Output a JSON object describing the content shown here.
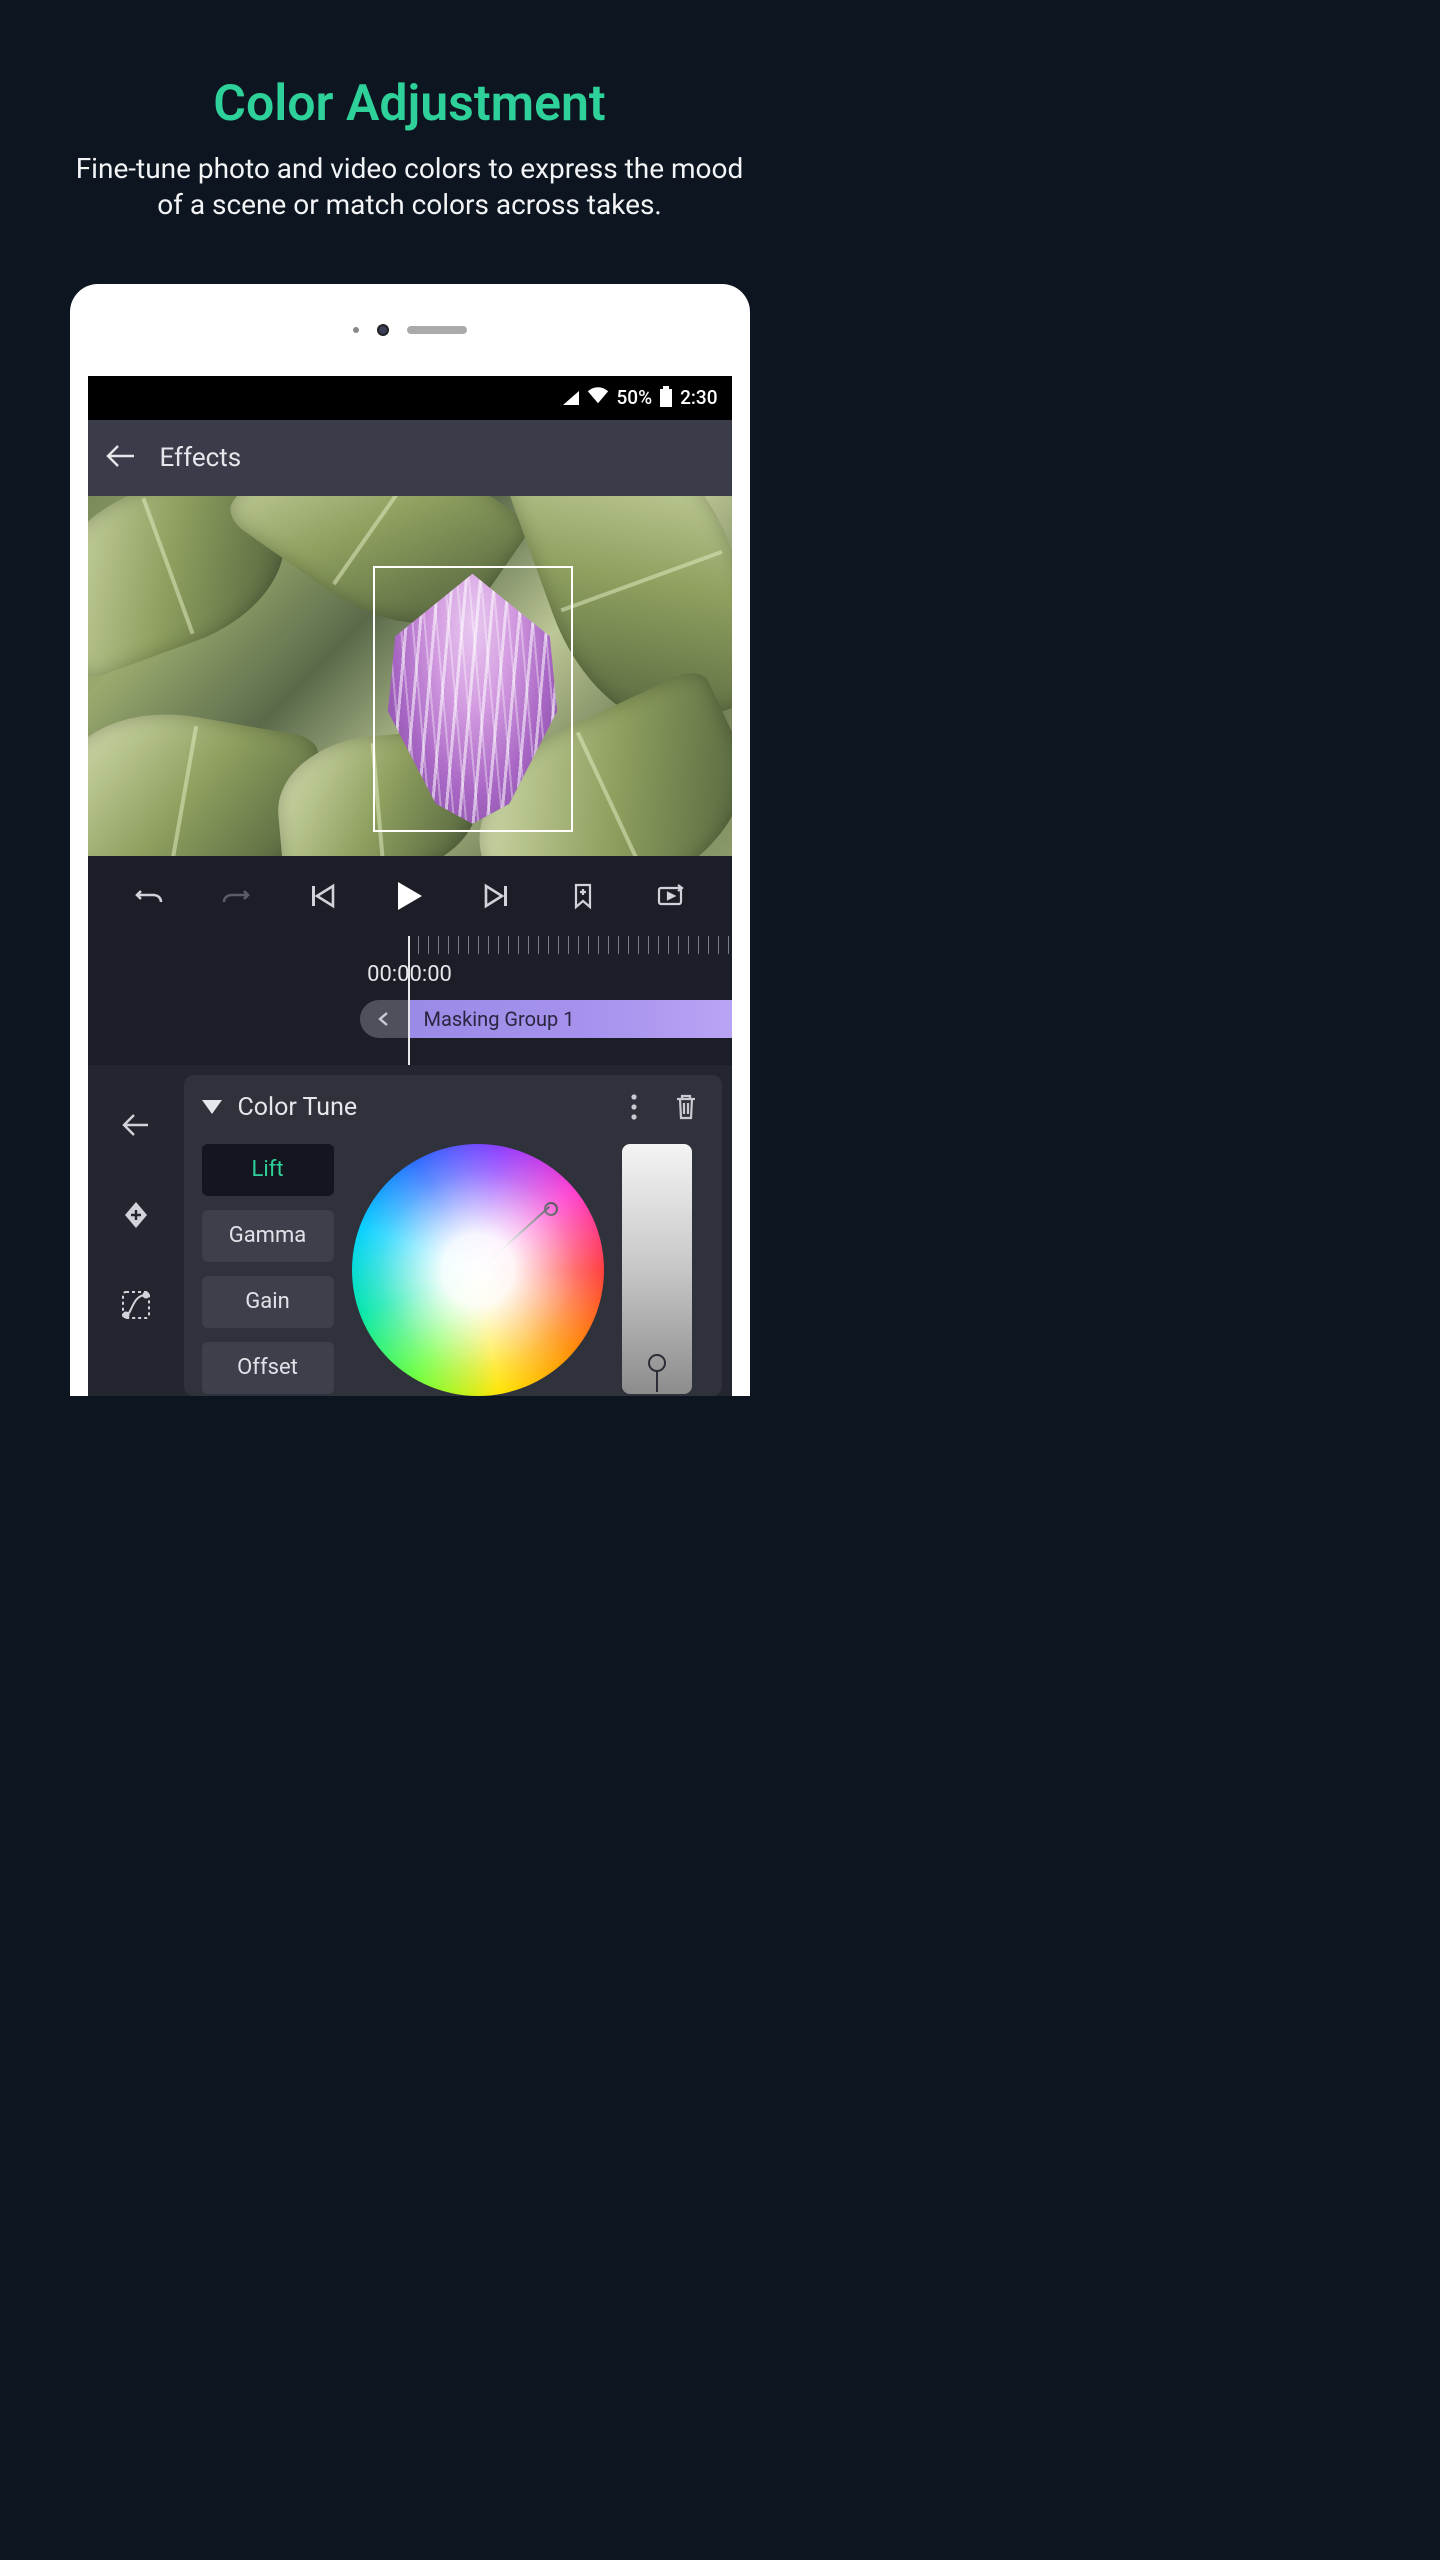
{
  "hero": {
    "title": "Color Adjustment",
    "subtitle": "Fine-tune photo and video colors to express the mood of a scene or match colors across takes."
  },
  "status": {
    "battery_pct": "50%",
    "time": "2:30"
  },
  "topbar": {
    "title": "Effects"
  },
  "timeline": {
    "timecode": "00:00:00",
    "clip_label": "Masking Group 1"
  },
  "panel": {
    "title": "Color Tune",
    "modes": [
      "Lift",
      "Gamma",
      "Gain",
      "Offset"
    ],
    "active_mode_index": 0
  },
  "icons": {
    "back": "back-arrow-icon",
    "undo": "undo-icon",
    "redo": "redo-icon",
    "to_start": "skip-start-icon",
    "play": "play-icon",
    "to_end": "skip-end-icon",
    "bookmark_add": "bookmark-add-icon",
    "loop": "loop-icon",
    "panel_back": "back-arrow-icon",
    "diamond_add": "keyframe-add-icon",
    "curve": "curve-icon",
    "more": "more-vertical-icon",
    "trash": "trash-icon",
    "chevron_left": "chevron-left-icon",
    "dropdown": "triangle-down-icon"
  },
  "colors": {
    "accent": "#2ed199",
    "clip": "#a893ee"
  }
}
